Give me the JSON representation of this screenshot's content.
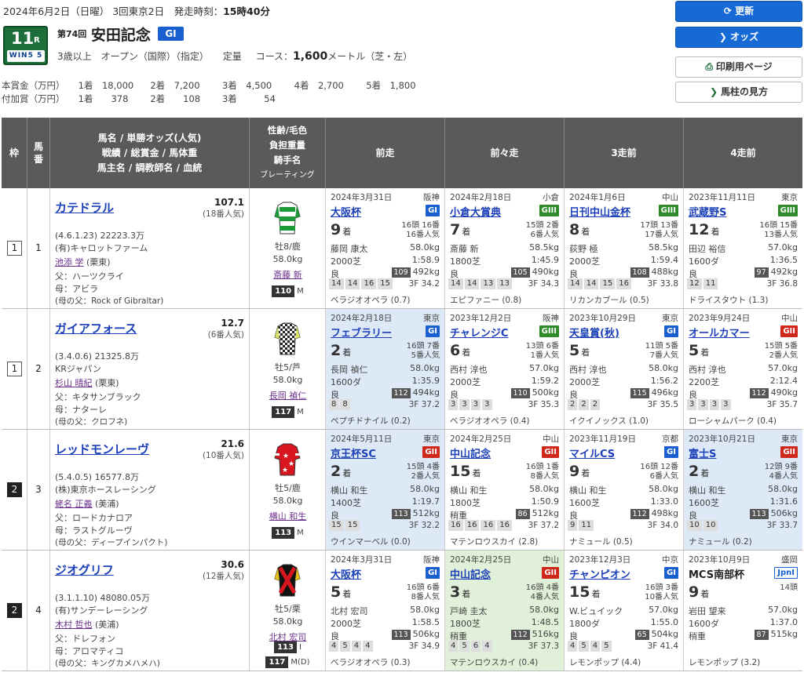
{
  "header": {
    "date_line": "2024年6月2日（日曜） 3回東京2日　発走時刻：",
    "post_time": "15時40分",
    "race_no": "11",
    "race_r": "R",
    "win5_label": "WIN5 5",
    "kai": "第74回",
    "race_name": "安田記念",
    "grade": "GI",
    "conditions": "3歳以上　オープン（国際）（指定）",
    "weight_rule": "定量",
    "course_label": "コース：",
    "distance": "1,600",
    "distance_unit": "メートル（芝・左）",
    "prize_label": "本賞金（万円）",
    "prize": [
      "1着　18,000",
      "2着　7,200",
      "3着　4,500",
      "4着　2,700",
      "5着　1,800"
    ],
    "addprize_label": "付加賞（万円）",
    "addprize": [
      "1着　　378",
      "2着　　108",
      "3着　　　54"
    ]
  },
  "buttons": {
    "refresh": "更新",
    "odds": "オッズ",
    "print": "印刷用ページ",
    "howto": "馬柱の見方"
  },
  "table_headers": {
    "waku": "枠",
    "uma": "馬番",
    "horse": [
      "馬名 / 単勝オッズ(人気)",
      "戦績 / 総賞金 / 馬体重",
      "馬主名 / 調教師名 / 血統"
    ],
    "jockey": [
      "性齢/毛色",
      "負担重量",
      "騎手名",
      "ブレーティング"
    ],
    "past": [
      "前走",
      "前々走",
      "3走前",
      "4走前"
    ]
  },
  "horses": [
    {
      "waku": "1",
      "waku_black": false,
      "uma": "1",
      "name": "カテドラル",
      "odds": "107.1",
      "pop": "(18番人気)",
      "record": "(4.6.1.23)  22223.3万",
      "owner": "(有)キャロットファーム",
      "trainer": "池添 学",
      "trainer_area": " (栗東)",
      "sire": "父：ハーツクライ",
      "dam": "母：アビラ",
      "damsire": "(母の父：Rock of Gibraltar)",
      "silk": "green-white",
      "sex": "牡8/鹿",
      "weight": "58.0kg",
      "jockey": "斎藤 新",
      "rating": "110",
      "rating_m": "M",
      "past": [
        {
          "date": "2024年3月31日",
          "venue": "阪神",
          "race": "大阪杯",
          "grade": "GI",
          "gcls": "gI",
          "rank": "9",
          "field": [
            "16頭 16番",
            "16番人気"
          ],
          "jock": "藤岡 康太",
          "wt": "58.0kg",
          "course": "2000芝",
          "time": "1:58.9",
          "cond": "良",
          "idx": "109",
          "bw": "492kg",
          "corners": [
            "14",
            "14",
            "16",
            "15"
          ],
          "last3": "3F 34.2",
          "winner": "ベラジオオペラ (0.7)",
          "hl": ""
        },
        {
          "date": "2024年2月18日",
          "venue": "小倉",
          "race": "小倉大賞典",
          "grade": "GIII",
          "gcls": "gIII",
          "rank": "7",
          "field": [
            "15頭 2番",
            "6番人気"
          ],
          "jock": "斎藤 新",
          "wt": "58.5kg",
          "course": "1800芝",
          "time": "1:45.9",
          "cond": "良",
          "idx": "105",
          "bw": "490kg",
          "corners": [
            "14",
            "14",
            "13",
            "13"
          ],
          "last3": "3F 34.3",
          "winner": "エピファニー (0.8)",
          "hl": ""
        },
        {
          "date": "2024年1月6日",
          "venue": "中山",
          "race": "日刊中山金杯",
          "grade": "GIII",
          "gcls": "gIII",
          "rank": "8",
          "field": [
            "17頭 13番",
            "17番人気"
          ],
          "jock": "荻野 極",
          "wt": "58.5kg",
          "course": "2000芝",
          "time": "1:59.4",
          "cond": "良",
          "idx": "108",
          "bw": "488kg",
          "corners": [
            "14",
            "14",
            "15",
            "16"
          ],
          "last3": "3F 33.8",
          "winner": "リカンカブール (0.5)",
          "hl": ""
        },
        {
          "date": "2023年11月11日",
          "venue": "東京",
          "race": "武蔵野S",
          "grade": "GIII",
          "gcls": "gIII",
          "rank": "12",
          "field": [
            "16頭 15番",
            "13番人気"
          ],
          "jock": "田辺 裕信",
          "wt": "57.0kg",
          "course": "1600ダ",
          "time": "1:36.5",
          "cond": "良",
          "idx": "97",
          "bw": "492kg",
          "corners": [
            "12",
            "11"
          ],
          "last3": "3F 36.8",
          "winner": "ドライスタウト (1.3)",
          "hl": ""
        }
      ]
    },
    {
      "waku": "1",
      "waku_black": false,
      "uma": "2",
      "name": "ガイアフォース",
      "odds": "12.7",
      "pop": "(6番人気)",
      "record": "(3.4.0.6)  21325.8万",
      "owner": "KRジャパン",
      "trainer": "杉山 晴紀",
      "trainer_area": " (栗東)",
      "sire": "父：キタサンブラック",
      "dam": "母：ナターレ",
      "damsire": "(母の父：クロフネ)",
      "silk": "checker",
      "sex": "牡5/芦",
      "weight": "58.0kg",
      "jockey": "長岡 禎仁",
      "rating": "117",
      "rating_m": "M",
      "past": [
        {
          "date": "2024年2月18日",
          "venue": "東京",
          "race": "フェブラリー",
          "grade": "GI",
          "gcls": "gI",
          "rank": "2",
          "field": [
            "16頭 7番",
            "5番人気"
          ],
          "jock": "長岡 禎仁",
          "wt": "58.0kg",
          "course": "1600ダ",
          "time": "1:35.9",
          "cond": "良",
          "idx": "112",
          "bw": "494kg",
          "corners": [
            "8",
            "8"
          ],
          "last3": "3F 37.2",
          "winner": "ペプチドナイル (0.2)",
          "hl": "hl-blue"
        },
        {
          "date": "2023年12月2日",
          "venue": "阪神",
          "race": "チャレンジC",
          "grade": "GIII",
          "gcls": "gIII",
          "rank": "6",
          "field": [
            "13頭 6番",
            "1番人気"
          ],
          "jock": "西村 淳也",
          "wt": "57.0kg",
          "course": "2000芝",
          "time": "1:59.2",
          "cond": "良",
          "idx": "110",
          "bw": "500kg",
          "corners": [
            "3",
            "3",
            "3",
            "3"
          ],
          "last3": "3F 35.3",
          "winner": "ベラジオオペラ (0.4)",
          "hl": ""
        },
        {
          "date": "2023年10月29日",
          "venue": "東京",
          "race": "天皇賞(秋)",
          "grade": "GI",
          "gcls": "gI",
          "rank": "5",
          "field": [
            "11頭 5番",
            "7番人気"
          ],
          "jock": "西村 淳也",
          "wt": "58.0kg",
          "course": "2000芝",
          "time": "1:56.2",
          "cond": "良",
          "idx": "115",
          "bw": "496kg",
          "corners": [
            "2",
            "2",
            "2"
          ],
          "last3": "3F 35.5",
          "winner": "イクイノックス (1.0)",
          "hl": ""
        },
        {
          "date": "2023年9月24日",
          "venue": "中山",
          "race": "オールカマー",
          "grade": "GII",
          "gcls": "gII",
          "rank": "5",
          "field": [
            "15頭 5番",
            "2番人気"
          ],
          "jock": "西村 淳也",
          "wt": "57.0kg",
          "course": "2200芝",
          "time": "2:12.4",
          "cond": "良",
          "idx": "112",
          "bw": "490kg",
          "corners": [
            "3",
            "3",
            "3",
            "3"
          ],
          "last3": "3F 35.7",
          "winner": "ローシャムパーク (0.4)",
          "hl": ""
        }
      ]
    },
    {
      "waku": "2",
      "waku_black": true,
      "uma": "3",
      "name": "レッドモンレーヴ",
      "odds": "21.6",
      "pop": "(10番人気)",
      "record": "(5.4.0.5)  16577.8万",
      "owner": "(株)東京ホースレーシング",
      "trainer": "蛯名 正義",
      "trainer_area": " (美浦)",
      "sire": "父：ロードカナロア",
      "dam": "母：ラストグルーヴ",
      "damsire": "(母の父：ディープインパクト)",
      "silk": "red-star",
      "sex": "牡5/鹿",
      "weight": "58.0kg",
      "jockey": "横山 和生",
      "rating": "113",
      "rating_m": "M",
      "past": [
        {
          "date": "2024年5月11日",
          "venue": "東京",
          "race": "京王杯SC",
          "grade": "GII",
          "gcls": "gII",
          "rank": "2",
          "field": [
            "15頭 4番",
            "2番人気"
          ],
          "jock": "横山 和生",
          "wt": "58.0kg",
          "course": "1400芝",
          "time": "1:19.7",
          "cond": "良",
          "idx": "113",
          "bw": "512kg",
          "corners": [
            "15",
            "15"
          ],
          "last3": "3F 32.2",
          "winner": "ウインマーベル (0.0)",
          "hl": "hl-blue"
        },
        {
          "date": "2024年2月25日",
          "venue": "中山",
          "race": "中山記念",
          "grade": "GII",
          "gcls": "gII",
          "rank": "15",
          "field": [
            "16頭 1番",
            "8番人気"
          ],
          "jock": "横山 和生",
          "wt": "58.0kg",
          "course": "1800芝",
          "time": "1:50.9",
          "cond": "稍重",
          "idx": "86",
          "bw": "512kg",
          "corners": [
            "16",
            "16",
            "16",
            "16"
          ],
          "last3": "3F 37.2",
          "winner": "マテンロウスカイ (2.8)",
          "hl": ""
        },
        {
          "date": "2023年11月19日",
          "venue": "京都",
          "race": "マイルCS",
          "grade": "GI",
          "gcls": "gI",
          "rank": "9",
          "field": [
            "16頭 12番",
            "6番人気"
          ],
          "jock": "横山 和生",
          "wt": "58.0kg",
          "course": "1600芝",
          "time": "1:33.0",
          "cond": "良",
          "idx": "112",
          "bw": "498kg",
          "corners": [
            "9",
            "11"
          ],
          "last3": "3F 34.0",
          "winner": "ナミュール (0.5)",
          "hl": ""
        },
        {
          "date": "2023年10月21日",
          "venue": "東京",
          "race": "富士S",
          "grade": "GII",
          "gcls": "gII",
          "rank": "2",
          "field": [
            "12頭 9番",
            "4番人気"
          ],
          "jock": "横山 和生",
          "wt": "58.0kg",
          "course": "1600芝",
          "time": "1:31.6",
          "cond": "良",
          "idx": "113",
          "bw": "506kg",
          "corners": [
            "10",
            "10"
          ],
          "last3": "3F 33.7",
          "winner": "ナミュール (0.2)",
          "hl": "hl-blue"
        }
      ]
    },
    {
      "waku": "2",
      "waku_black": true,
      "uma": "4",
      "name": "ジオグリフ",
      "odds": "30.6",
      "pop": "(12番人気)",
      "record": "(3.1.1.10)  48080.05万",
      "owner": "(有)サンデーレーシング",
      "trainer": "木村 哲也",
      "trainer_area": " (美浦)",
      "sire": "父：ドレフォン",
      "dam": "母：アロマティコ",
      "damsire": "(母の父：キングカメハメハ)",
      "silk": "black-red",
      "sex": "牡5/栗",
      "weight": "58.0kg",
      "jockey": "北村 宏司",
      "rating": "113",
      "rating_m": "I",
      "rating2": "117",
      "rating2_m": "M(D)",
      "past": [
        {
          "date": "2024年3月31日",
          "venue": "阪神",
          "race": "大阪杯",
          "grade": "GI",
          "gcls": "gI",
          "rank": "5",
          "field": [
            "16頭 6番",
            "8番人気"
          ],
          "jock": "北村 宏司",
          "wt": "58.0kg",
          "course": "2000芝",
          "time": "1:58.5",
          "cond": "良",
          "idx": "113",
          "bw": "506kg",
          "corners": [
            "4",
            "5",
            "4",
            "4"
          ],
          "last3": "3F 34.9",
          "winner": "ベラジオオペラ (0.3)",
          "hl": ""
        },
        {
          "date": "2024年2月25日",
          "venue": "中山",
          "race": "中山記念",
          "grade": "GII",
          "gcls": "gII",
          "rank": "3",
          "field": [
            "16頭 4番",
            "4番人気"
          ],
          "jock": "戸崎 圭太",
          "wt": "58.0kg",
          "course": "1800芝",
          "time": "1:48.5",
          "cond": "稍重",
          "idx": "112",
          "bw": "516kg",
          "corners": [
            "4",
            "5",
            "6",
            "4"
          ],
          "last3": "3F 37.3",
          "winner": "マテンロウスカイ (0.4)",
          "hl": "hl-green"
        },
        {
          "date": "2023年12月3日",
          "venue": "中京",
          "race": "チャンピオン",
          "grade": "GI",
          "gcls": "gI",
          "rank": "15",
          "field": [
            "16頭 3番",
            "10番人気"
          ],
          "jock": "W.ビュイック",
          "wt": "57.0kg",
          "course": "1800ダ",
          "time": "1:55.0",
          "cond": "良",
          "idx": "65",
          "bw": "504kg",
          "corners": [
            "4",
            "5",
            "4",
            "5"
          ],
          "last3": "3F 41.4",
          "winner": "レモンポップ (4.4)",
          "hl": ""
        },
        {
          "date": "2023年10月9日",
          "venue": "盛岡",
          "race": "MCS南部杯",
          "grade": "JpnI",
          "gcls": "gJ",
          "rank": "9",
          "field": [
            "14頭",
            ""
          ],
          "jock": "岩田 望来",
          "wt": "57.0kg",
          "course": "1600ダ",
          "time": "1:37.0",
          "cond": "稍重",
          "idx": "87",
          "bw": "515kg",
          "corners": [],
          "last3": "",
          "winner": "レモンポップ (3.2)",
          "hl": "",
          "plain": true
        }
      ]
    }
  ]
}
